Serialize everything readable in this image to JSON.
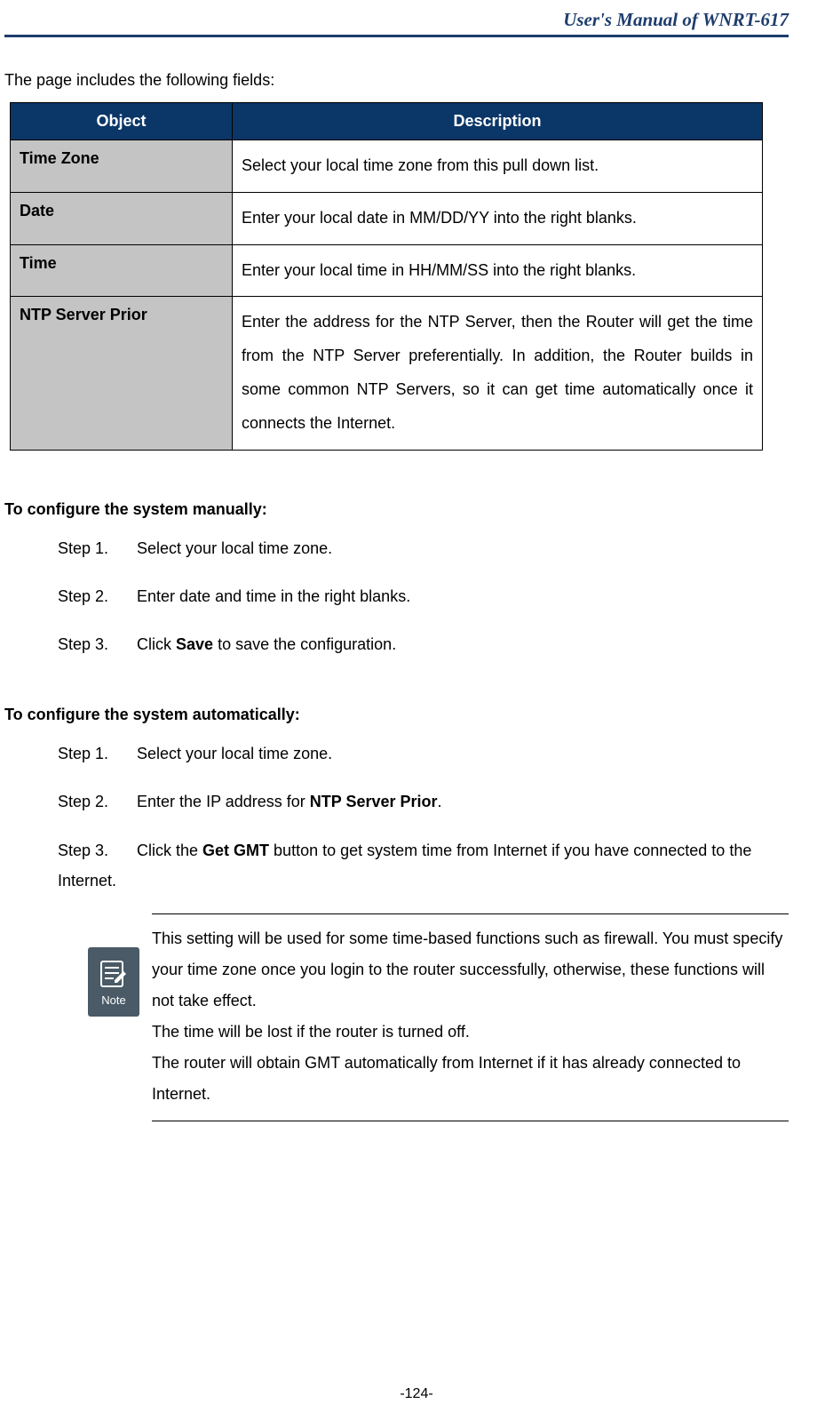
{
  "header": {
    "title": "User's Manual of WNRT-617"
  },
  "intro": "The page includes the following fields:",
  "table": {
    "head": {
      "object": "Object",
      "description": "Description"
    },
    "rows": [
      {
        "object": "Time Zone",
        "desc": "Select your local time zone from this pull down list."
      },
      {
        "object": "Date",
        "desc": "Enter your local date in MM/DD/YY into the right blanks."
      },
      {
        "object": "Time",
        "desc": "Enter your local time in HH/MM/SS into the right blanks."
      },
      {
        "object": "NTP Server Prior",
        "desc": "Enter the address for the NTP Server, then the Router will get the time from the NTP Server preferentially. In addition, the Router builds in some common NTP Servers, so it can get time automatically once it connects the Internet."
      }
    ]
  },
  "manual": {
    "heading": "To configure the system manually:",
    "steps": [
      {
        "label": "Step 1.",
        "pre": "Select your local time zone.",
        "bold": "",
        "post": ""
      },
      {
        "label": "Step 2.",
        "pre": "Enter date and time in the right blanks.",
        "bold": "",
        "post": ""
      },
      {
        "label": "Step 3.",
        "pre": "Click ",
        "bold": "Save",
        "post": " to save the configuration."
      }
    ]
  },
  "auto": {
    "heading": "To configure the system automatically:",
    "steps": [
      {
        "label": "Step 1.",
        "pre": "Select your local time zone.",
        "bold": "",
        "post": ""
      },
      {
        "label": "Step 2.",
        "pre": "Enter the IP address for ",
        "bold": "NTP Server Prior",
        "post": "."
      },
      {
        "label": "Step 3.",
        "pre": "Click the ",
        "bold": "Get GMT",
        "post": " button to get system time from Internet if you have connected to the Internet."
      }
    ]
  },
  "note": {
    "icon_label": "Note",
    "p1": "This setting will be used for some time-based functions such as firewall. You must specify your time zone once you login to the router successfully, otherwise, these functions will not take effect.",
    "p2": "The time will be lost if the router is turned off.",
    "p3": "The router will obtain GMT automatically from Internet if it has already connected to Internet."
  },
  "page_number": "-124-"
}
